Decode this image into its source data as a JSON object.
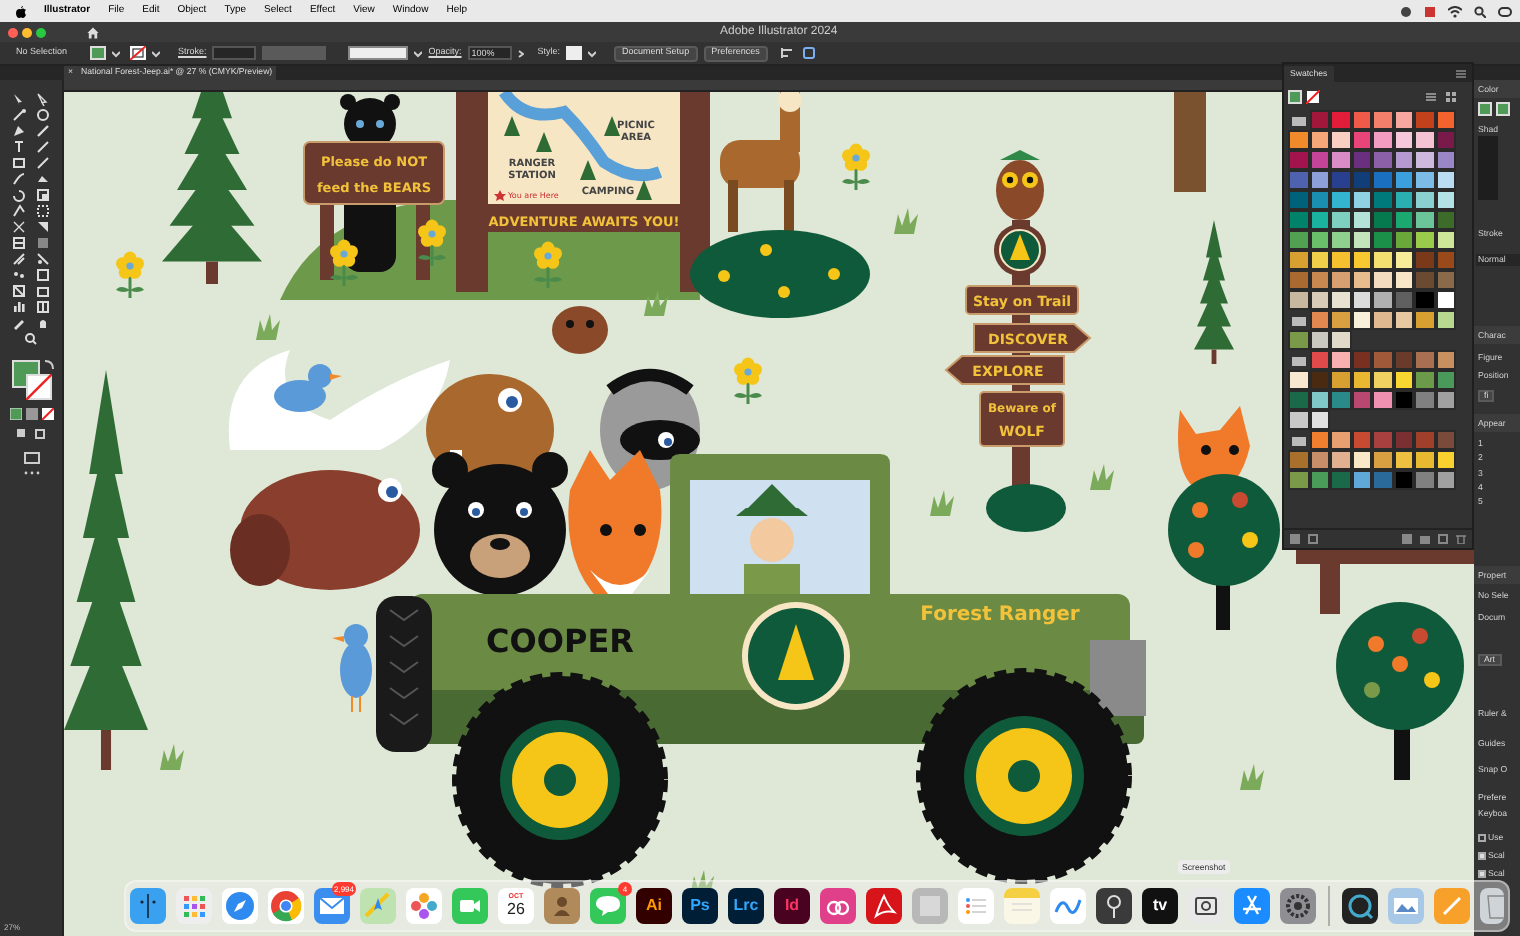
{
  "menu_bar": {
    "app": "Illustrator",
    "items": [
      "File",
      "Edit",
      "Object",
      "Type",
      "Select",
      "Effect",
      "View",
      "Window",
      "Help"
    ]
  },
  "title_bar": {
    "title": "Adobe Illustrator 2024"
  },
  "control_bar": {
    "selection": "No Selection",
    "stroke_label": "Stroke:",
    "opacity_label": "Opacity:",
    "opacity": "100%",
    "style_label": "Style:",
    "buttons": [
      "Document Setup",
      "Preferences"
    ]
  },
  "document_tab": {
    "close": "×",
    "title": "National Forest-Jeep.ai* @ 27 % (CMYK/Preview)"
  },
  "artboard": {
    "bear_sign": [
      "Please do NOT",
      "feed the BEARS"
    ],
    "map": {
      "picnic": [
        "PICNIC",
        "AREA"
      ],
      "ranger": [
        "RANGER",
        "STATION"
      ],
      "camping": "CAMPING",
      "here": "You are Here",
      "banner": "ADVENTURE AWAITS YOU!"
    },
    "trail_signs": [
      {
        "kind": "plain",
        "lines": [
          "Stay on Trail"
        ]
      },
      {
        "kind": "arrow_right",
        "lines": [
          "DISCOVER"
        ]
      },
      {
        "kind": "arrow_left",
        "lines": [
          "EXPLORE"
        ]
      },
      {
        "kind": "plain",
        "lines": [
          "Beware of",
          "WOLF"
        ]
      }
    ],
    "jeep_name": "COOPER",
    "jeep_title": "Forest Ranger"
  },
  "swatches": {
    "title": "Swatches",
    "rows": [
      {
        "folder": true,
        "swatches": [
          {
            "color": "#a0173b"
          },
          {
            "color": "#e11d3a"
          },
          {
            "color": "#f05a4a"
          },
          {
            "color": "#f47f6a"
          },
          {
            "color": "#f7a6a0"
          },
          {
            "color": "#c2411d"
          },
          {
            "color": "#f4622d"
          }
        ]
      },
      {
        "folder": false,
        "swatches": [
          {
            "color": "#f08a2a"
          },
          {
            "color": "#f6a77a"
          },
          {
            "color": "#f9cfc4"
          },
          {
            "color": "#e9457a"
          },
          {
            "color": "#f19cc0"
          },
          {
            "color": "#f7c8dc"
          },
          {
            "color": "#f4c2d2"
          },
          {
            "color": "#7a1a4a"
          }
        ]
      },
      {
        "folder": false,
        "swatches": [
          {
            "color": "#a3144f"
          },
          {
            "color": "#c4449a"
          },
          {
            "color": "#d98cc6"
          },
          {
            "color": "#6b2f7f"
          },
          {
            "color": "#8b60a8"
          },
          {
            "color": "#b49ad0"
          },
          {
            "color": "#cdb9e0"
          },
          {
            "color": "#9a87c6"
          }
        ]
      },
      {
        "folder": false,
        "swatches": [
          {
            "color": "#4e62b0"
          },
          {
            "color": "#8ea0d8"
          },
          {
            "color": "#28408f"
          },
          {
            "color": "#113e79"
          },
          {
            "color": "#1b6fbf"
          },
          {
            "color": "#3ba0dc"
          },
          {
            "color": "#7bbbe6"
          },
          {
            "color": "#b9dcf3"
          }
        ]
      },
      {
        "folder": false,
        "swatches": [
          {
            "color": "#00627a"
          },
          {
            "color": "#1a8fb0"
          },
          {
            "color": "#33b5d0"
          },
          {
            "color": "#90d2e4"
          },
          {
            "color": "#007a7a"
          },
          {
            "color": "#2ab0b0"
          },
          {
            "color": "#8bd0d0"
          },
          {
            "color": "#b4e3e6"
          }
        ]
      },
      {
        "folder": false,
        "swatches": [
          {
            "color": "#00836a"
          },
          {
            "color": "#19b3a0"
          },
          {
            "color": "#7fcfc0"
          },
          {
            "color": "#b5e2d6"
          },
          {
            "color": "#067a4f"
          },
          {
            "color": "#1aa870"
          },
          {
            "color": "#6cc49a"
          },
          {
            "color": "#3d6b2a"
          }
        ]
      },
      {
        "folder": false,
        "swatches": [
          {
            "color": "#52a052"
          },
          {
            "color": "#6abf6a"
          },
          {
            "color": "#8fd08f"
          },
          {
            "color": "#c4e4bc"
          },
          {
            "color": "#1a9048"
          },
          {
            "color": "#6aa83a"
          },
          {
            "color": "#9acb4a"
          },
          {
            "color": "#cfe59a"
          }
        ]
      },
      {
        "folder": false,
        "swatches": [
          {
            "color": "#d8a030"
          },
          {
            "color": "#f0d04a"
          },
          {
            "color": "#f4c030"
          },
          {
            "color": "#f8c830"
          },
          {
            "color": "#f4e070"
          },
          {
            "color": "#f8ec98"
          },
          {
            "color": "#7a3a1a"
          },
          {
            "color": "#9a4a1a"
          }
        ]
      },
      {
        "folder": false,
        "swatches": [
          {
            "color": "#a86a30"
          },
          {
            "color": "#c88850"
          },
          {
            "color": "#d8a070"
          },
          {
            "color": "#e8bc8c"
          },
          {
            "color": "#f4dcc0"
          },
          {
            "color": "#f8e6c8"
          },
          {
            "color": "#6a4a30"
          },
          {
            "color": "#8a6a4a"
          }
        ]
      },
      {
        "folder": false,
        "swatches": [
          {
            "color": "#c8b8a0"
          },
          {
            "color": "#d8ccb8"
          },
          {
            "color": "#e8e0d0"
          },
          {
            "color": "#dcdcdc"
          },
          {
            "color": "#b0b0b0"
          },
          {
            "color": "#606060"
          },
          {
            "color": "#000000"
          },
          {
            "color": "#ffffff"
          }
        ]
      },
      {
        "folder": true,
        "swatches": [
          {
            "color": "#e08850"
          },
          {
            "color": "#d8a040"
          },
          {
            "color": "#f8f0d8"
          },
          {
            "color": "#e0b890"
          },
          {
            "color": "#e8c8a0"
          },
          {
            "color": "#d8a030"
          },
          {
            "color": "#b8d890"
          }
        ]
      },
      {
        "folder": false,
        "swatches": [
          {
            "color": "#7a9a4a"
          },
          {
            "color": "#c8c8c0"
          },
          {
            "color": "#e0d8c8"
          }
        ]
      },
      {
        "folder": true,
        "swatches": [
          {
            "color": "#e04a4a"
          },
          {
            "color": "#f8b0b0"
          },
          {
            "color": "#7a3020"
          },
          {
            "color": "#a05a3a"
          },
          {
            "color": "#6a3a2a"
          },
          {
            "color": "#a87050"
          },
          {
            "color": "#c89060"
          }
        ]
      },
      {
        "folder": false,
        "swatches": [
          {
            "color": "#f8e8d0"
          },
          {
            "color": "#4a2a10"
          },
          {
            "color": "#d8a030"
          },
          {
            "color": "#e8b830"
          },
          {
            "color": "#f0d060"
          },
          {
            "color": "#f8d830"
          },
          {
            "color": "#6a9a4a"
          },
          {
            "color": "#4a9a5a"
          }
        ]
      },
      {
        "folder": false,
        "swatches": [
          {
            "color": "#1a6a4a"
          },
          {
            "color": "#80c8c8"
          },
          {
            "color": "#2a8a8a"
          },
          {
            "color": "#b84870"
          },
          {
            "color": "#f090b0"
          },
          {
            "color": "#000000"
          },
          {
            "color": "#808080"
          },
          {
            "color": "#a0a0a0"
          }
        ]
      },
      {
        "folder": false,
        "swatches": [
          {
            "color": "#c8c8c8"
          },
          {
            "color": "#e0e0e0"
          }
        ]
      },
      {
        "folder": true,
        "swatches": [
          {
            "color": "#f08030"
          },
          {
            "color": "#e8a070"
          },
          {
            "color": "#c84a30"
          },
          {
            "color": "#a84040"
          },
          {
            "color": "#7a3030"
          },
          {
            "color": "#a0402a"
          },
          {
            "color": "#7a4a3a"
          }
        ]
      },
      {
        "folder": false,
        "swatches": [
          {
            "color": "#a8702a"
          },
          {
            "color": "#c8906a"
          },
          {
            "color": "#e0b090"
          },
          {
            "color": "#f8e8c8"
          },
          {
            "color": "#d8a040"
          },
          {
            "color": "#f0c040"
          },
          {
            "color": "#e8b830"
          },
          {
            "color": "#f8d030"
          }
        ]
      },
      {
        "folder": false,
        "swatches": [
          {
            "color": "#7a9a4a"
          },
          {
            "color": "#4a9a5a"
          },
          {
            "color": "#1a6a4a"
          },
          {
            "color": "#60a8d8"
          },
          {
            "color": "#2a6a9a"
          },
          {
            "color": "#000000"
          },
          {
            "color": "#808080"
          },
          {
            "color": "#a0a0a0"
          }
        ]
      }
    ]
  },
  "side_panel": {
    "items": [
      {
        "kind": "heading",
        "text": "Color"
      },
      {
        "kind": "label",
        "text": "Shad"
      },
      {
        "kind": "label",
        "text": "Stroke"
      },
      {
        "kind": "dropdown",
        "text": "Normal"
      },
      {
        "kind": "heading",
        "text": "Charac"
      },
      {
        "kind": "label",
        "text": "Figure"
      },
      {
        "kind": "label",
        "text": "Position"
      },
      {
        "kind": "button",
        "text": "fi"
      },
      {
        "kind": "heading",
        "text": "Appear"
      },
      {
        "kind": "label",
        "text": "1"
      },
      {
        "kind": "label",
        "text": "2"
      },
      {
        "kind": "label",
        "text": "3"
      },
      {
        "kind": "label",
        "text": "4"
      },
      {
        "kind": "label",
        "text": "5"
      },
      {
        "kind": "heading",
        "text": "Propert"
      },
      {
        "kind": "label",
        "text": "No Sele"
      },
      {
        "kind": "label",
        "text": "Docum"
      },
      {
        "kind": "button",
        "text": "Art"
      },
      {
        "kind": "label",
        "text": "Ruler &"
      },
      {
        "kind": "label",
        "text": "Guides"
      },
      {
        "kind": "label",
        "text": "Snap O"
      },
      {
        "kind": "label",
        "text": "Prefere"
      },
      {
        "kind": "label",
        "text": "Keyboa"
      },
      {
        "kind": "checkbox",
        "text": "Use",
        "checked": false
      },
      {
        "kind": "checkbox",
        "text": "Scal",
        "checked": true
      },
      {
        "kind": "checkbox",
        "text": "Scal",
        "checked": true
      }
    ]
  },
  "dock": {
    "tooltip": "Screenshot",
    "apps": [
      {
        "kind": "finder"
      },
      {
        "kind": "launchpad"
      },
      {
        "kind": "safari"
      },
      {
        "kind": "chrome"
      },
      {
        "kind": "mail",
        "badge": "2,994"
      },
      {
        "kind": "maps"
      },
      {
        "kind": "photos"
      },
      {
        "kind": "facetime"
      },
      {
        "kind": "calendar",
        "month": "OCT",
        "day": "26"
      },
      {
        "kind": "contacts"
      },
      {
        "kind": "messages",
        "badge": "4"
      },
      {
        "kind": "illustrator",
        "label": "Ai"
      },
      {
        "kind": "photoshop",
        "label": "Ps"
      },
      {
        "kind": "lightroom",
        "label": "Lrc"
      },
      {
        "kind": "indesign",
        "label": "Id"
      },
      {
        "kind": "creative_cloud"
      },
      {
        "kind": "acrobat"
      },
      {
        "kind": "font_book"
      },
      {
        "kind": "reminders"
      },
      {
        "kind": "notes"
      },
      {
        "kind": "freeform"
      },
      {
        "kind": "keychain"
      },
      {
        "kind": "tv",
        "label": "tv"
      },
      {
        "kind": "screenshot"
      },
      {
        "kind": "app_store"
      },
      {
        "kind": "system_settings"
      },
      {
        "kind": "divider"
      },
      {
        "kind": "quicktime"
      },
      {
        "kind": "preview"
      },
      {
        "kind": "pages"
      },
      {
        "kind": "trash"
      }
    ]
  },
  "status_bar": {
    "zoom": "27%"
  }
}
